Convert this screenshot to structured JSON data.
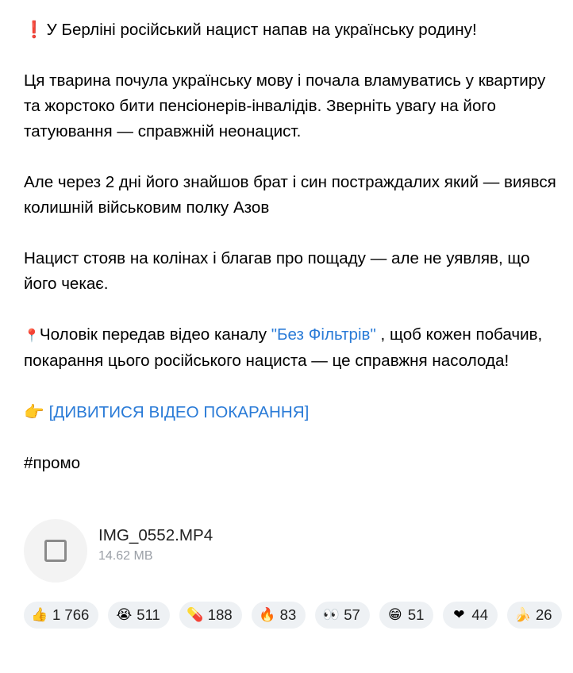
{
  "post": {
    "paragraphs": {
      "p1": {
        "icon": "❗",
        "text": "У Берліні російський нацист напав на українську родину!"
      },
      "p2": "Ця тварина почула українську мову і почала вламуватись у квартиру та жорстоко бити пенсіонерів-інвалідів. Зверніть увагу на його татуювання — справжній неонацист.",
      "p3": "Але через 2 дні його знайшов брат і син постраждалих який — виявся колишній військовим полку Азов",
      "p4": "Нацист стояв на колінах і благав про пощаду — але не уявляв, що його чекає.",
      "p5": {
        "icon": "📍",
        "before": "Чоловік передав відео каналу ",
        "link": "\"Без Фільтрів\"",
        "after": " , щоб кожен побачив, покарання цього російського нациста — це справжня насолода!"
      },
      "p6": {
        "icon": "👉",
        "link": "[ДИВИТИСЯ ВІДЕО ПОКАРАННЯ]"
      },
      "p7": "#промо"
    },
    "attachment": {
      "icon": "file-icon",
      "name": "IMG_0552.MP4",
      "size": "14.62 MB"
    },
    "reactions": [
      {
        "icon_name": "thumbs-up-icon",
        "emoji": "👍",
        "count": "1 766"
      },
      {
        "icon_name": "crying-face-icon",
        "emoji": "😭",
        "count": "511"
      },
      {
        "icon_name": "pill-icon",
        "emoji": "💊",
        "count": "188"
      },
      {
        "icon_name": "fire-icon",
        "emoji": "🔥",
        "count": "83"
      },
      {
        "icon_name": "eyes-icon",
        "emoji": "👀",
        "count": "57"
      },
      {
        "icon_name": "grinning-face-icon",
        "emoji": "😁",
        "count": "51"
      },
      {
        "icon_name": "heart-icon",
        "emoji": "❤",
        "count": "44"
      },
      {
        "icon_name": "banana-icon",
        "emoji": "🍌",
        "count": "26"
      }
    ]
  },
  "colors": {
    "link": "#2a7bd7",
    "reaction_bg": "#eef1f4",
    "muted": "#9a9fa6"
  }
}
